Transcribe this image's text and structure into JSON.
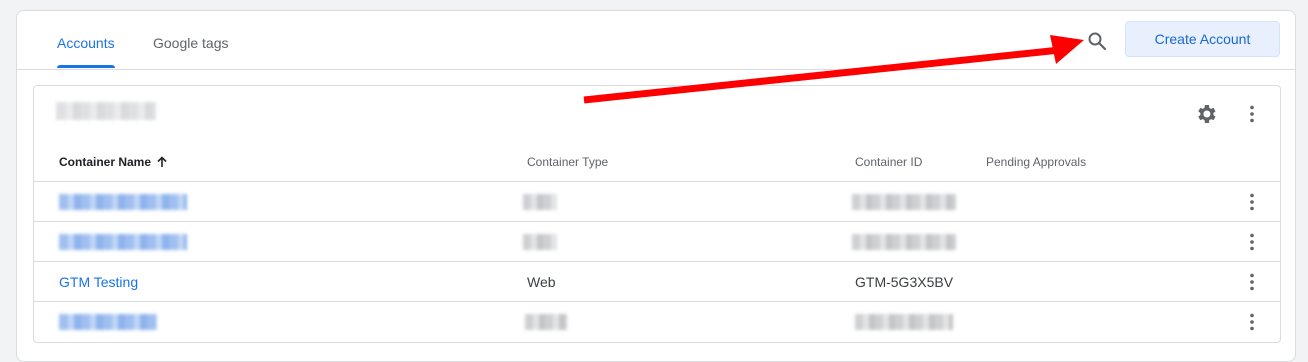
{
  "tabs": [
    {
      "label": "Accounts",
      "active": true
    },
    {
      "label": "Google tags",
      "active": false
    }
  ],
  "toolbar": {
    "search_icon": "search-icon",
    "create_label": "Create Account"
  },
  "account": {
    "name_redacted": true,
    "settings_icon": "gear-icon",
    "more_icon": "more-vert-icon"
  },
  "table": {
    "columns": [
      "Container Name",
      "Container Type",
      "Container ID",
      "Pending Approvals"
    ],
    "sort": {
      "column": "Container Name",
      "direction": "ascending",
      "icon": "arrow-up-icon"
    },
    "rows": [
      {
        "name": "",
        "type": "",
        "id": "",
        "pending": "",
        "redacted": true
      },
      {
        "name": "",
        "type": "",
        "id": "",
        "pending": "",
        "redacted": true
      },
      {
        "name": "GTM Testing",
        "type": "Web",
        "id": "GTM-5G3X5BV",
        "pending": "",
        "redacted": false
      },
      {
        "name": "",
        "type": "",
        "id": "",
        "pending": "",
        "redacted": true
      }
    ]
  },
  "annotation": {
    "type": "red-arrow",
    "points_to": "search-icon",
    "color": "#ff0000"
  },
  "colors": {
    "accent": "#1a73e8",
    "button_bg": "#e8f0fe",
    "border": "#dadce0"
  }
}
